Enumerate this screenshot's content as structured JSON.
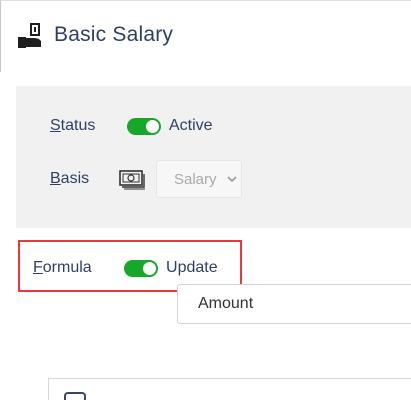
{
  "header": {
    "title": "Basic Salary",
    "icon": "salary-hand-icon"
  },
  "status": {
    "label_first": "S",
    "label_rest": "tatus",
    "toggle_on": true,
    "value": "Active"
  },
  "basis": {
    "label_first": "B",
    "label_rest": "asis",
    "icon": "money-bill-icon",
    "select_value": "Salary"
  },
  "formula": {
    "label_first": "F",
    "label_rest": "ormula",
    "toggle_on": true,
    "value_first": "U",
    "value_rest": "pdate"
  },
  "amount": {
    "value": "Amount"
  },
  "colors": {
    "accent_green": "#15a829",
    "text_navy": "#2f3e63",
    "highlight_red": "#e8373f",
    "panel_grey": "#f1f1f1"
  }
}
